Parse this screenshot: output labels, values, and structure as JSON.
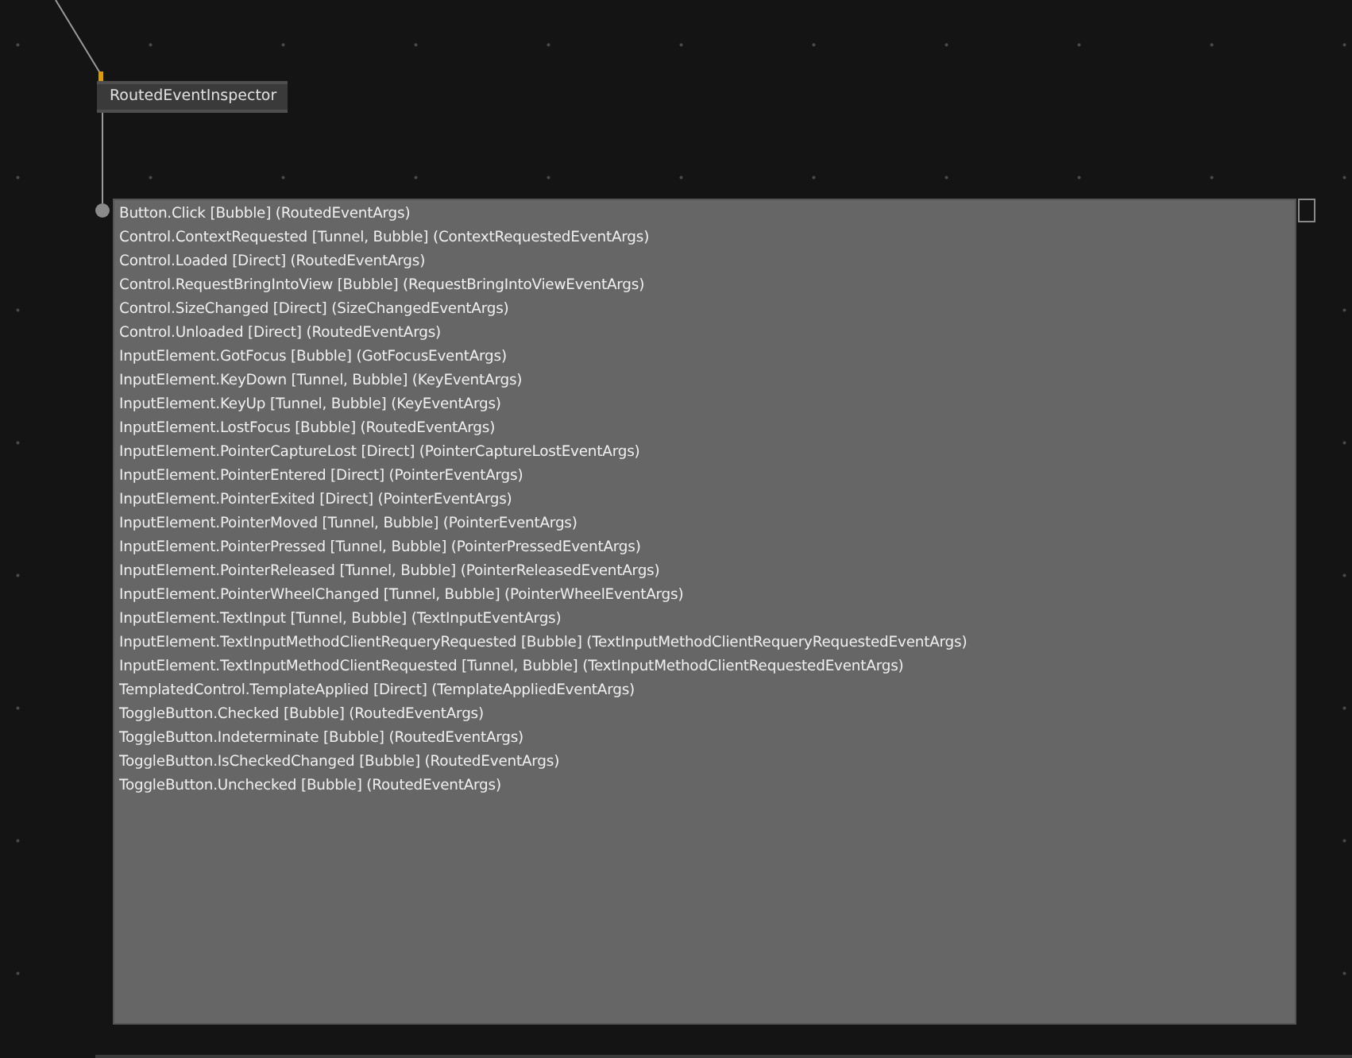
{
  "node": {
    "title": "RoutedEventInspector"
  },
  "events": [
    "Button.Click [Bubble] (RoutedEventArgs)",
    "Control.ContextRequested [Tunnel, Bubble] (ContextRequestedEventArgs)",
    "Control.Loaded [Direct] (RoutedEventArgs)",
    "Control.RequestBringIntoView [Bubble] (RequestBringIntoViewEventArgs)",
    "Control.SizeChanged [Direct] (SizeChangedEventArgs)",
    "Control.Unloaded [Direct] (RoutedEventArgs)",
    "InputElement.GotFocus [Bubble] (GotFocusEventArgs)",
    "InputElement.KeyDown [Tunnel, Bubble] (KeyEventArgs)",
    "InputElement.KeyUp [Tunnel, Bubble] (KeyEventArgs)",
    "InputElement.LostFocus [Bubble] (RoutedEventArgs)",
    "InputElement.PointerCaptureLost [Direct] (PointerCaptureLostEventArgs)",
    "InputElement.PointerEntered [Direct] (PointerEventArgs)",
    "InputElement.PointerExited [Direct] (PointerEventArgs)",
    "InputElement.PointerMoved [Tunnel, Bubble] (PointerEventArgs)",
    "InputElement.PointerPressed [Tunnel, Bubble] (PointerPressedEventArgs)",
    "InputElement.PointerReleased [Tunnel, Bubble] (PointerReleasedEventArgs)",
    "InputElement.PointerWheelChanged [Tunnel, Bubble] (PointerWheelEventArgs)",
    "InputElement.TextInput [Tunnel, Bubble] (TextInputEventArgs)",
    "InputElement.TextInputMethodClientRequeryRequested [Bubble] (TextInputMethodClientRequeryRequestedEventArgs)",
    "InputElement.TextInputMethodClientRequested [Tunnel, Bubble] (TextInputMethodClientRequestedEventArgs)",
    "TemplatedControl.TemplateApplied [Direct] (TemplateAppliedEventArgs)",
    "ToggleButton.Checked [Bubble] (RoutedEventArgs)",
    "ToggleButton.Indeterminate [Bubble] (RoutedEventArgs)",
    "ToggleButton.IsCheckedChanged [Bubble] (RoutedEventArgs)",
    "ToggleButton.Unchecked [Bubble] (RoutedEventArgs)"
  ]
}
